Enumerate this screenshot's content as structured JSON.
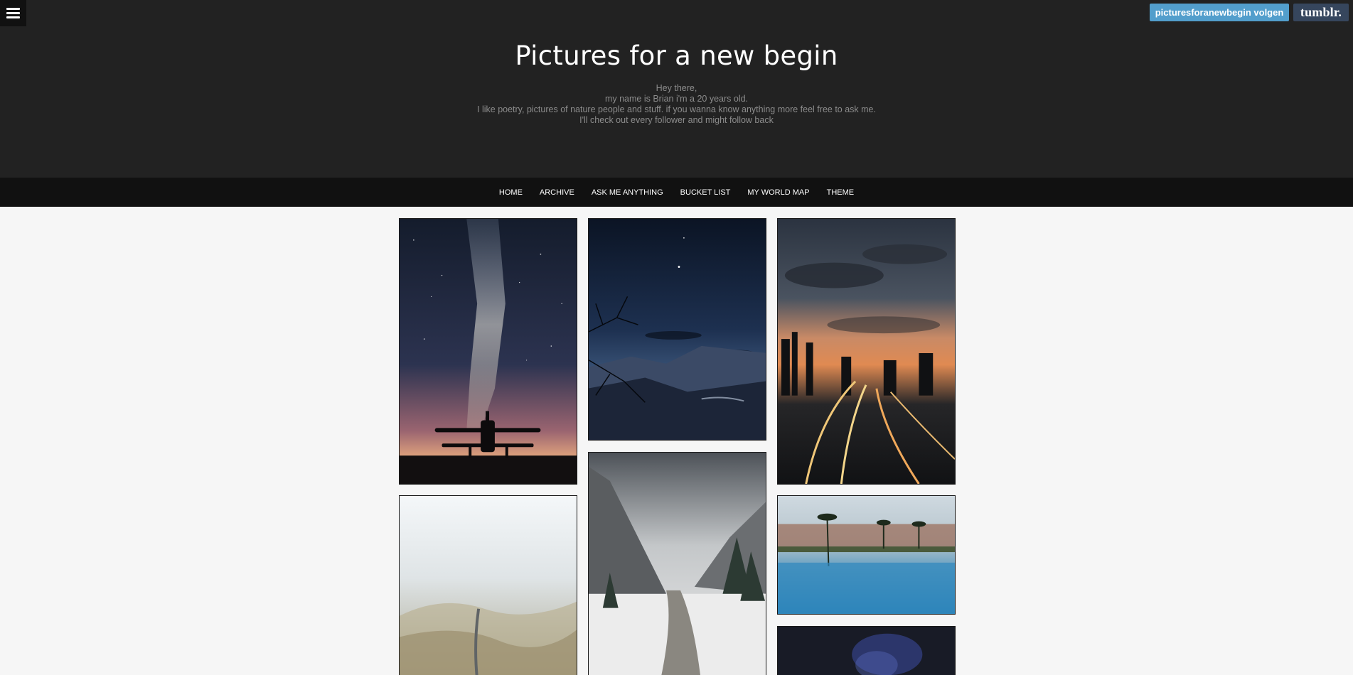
{
  "header": {
    "title": "Pictures for a new begin",
    "description": [
      "Hey there,",
      "my name is Brian i'm a 20 years old.",
      "I like poetry, pictures of nature people and stuff. if you wanna know anything more feel free to ask me.",
      "I'll check out every follower and might follow back"
    ]
  },
  "topbar": {
    "follow_label": "picturesforanewbegin volgen",
    "tumblr_label": "tumblr."
  },
  "nav": {
    "items": [
      "HOME",
      "ARCHIVE",
      "ASK ME ANYTHING",
      "BUCKET LIST",
      "MY WORLD MAP",
      "THEME"
    ]
  },
  "colors": {
    "header_bg": "#222222",
    "nav_bg": "#111111",
    "page_bg": "#f6f6f6",
    "follow_bg": "#529ecc",
    "tumblr_bg": "#36465d"
  },
  "icons": {
    "menu": "hamburger-menu-icon"
  },
  "posts": [
    {
      "subject": "milky-way-biplane"
    },
    {
      "subject": "night-mountains-branches"
    },
    {
      "subject": "city-highway-sunset"
    },
    {
      "subject": "misty-forest-road"
    },
    {
      "subject": "snowy-mountain-river"
    },
    {
      "subject": "palm-resort-pool"
    },
    {
      "subject": "night-sky-nebula"
    }
  ]
}
